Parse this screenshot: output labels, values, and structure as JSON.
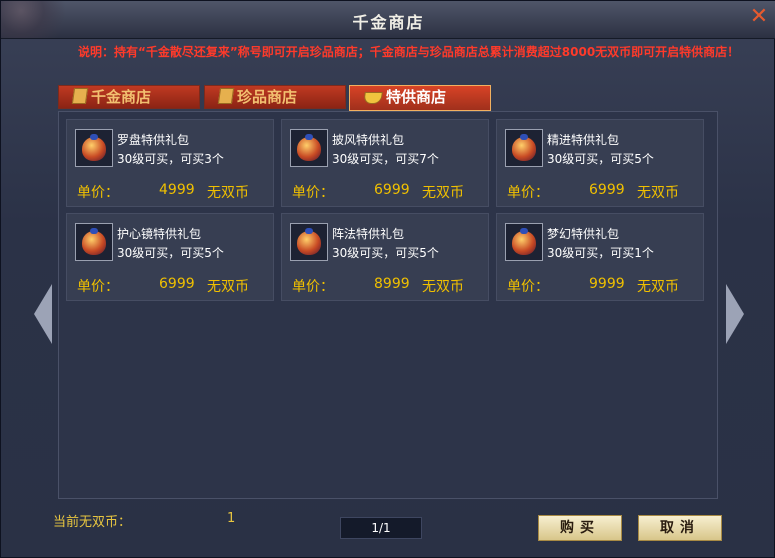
{
  "window": {
    "title": "千金商店",
    "close_label": "✕"
  },
  "notice": "说明：持有“千金散尽还复来”称号即可开启珍品商店；千金商店与珍品商店总累计消费超过8000无双币即可开启特供商店！",
  "tabs": [
    {
      "label": "千金商店",
      "active": false
    },
    {
      "label": "珍品商店",
      "active": false
    },
    {
      "label": "特供商店",
      "active": true
    }
  ],
  "items": [
    {
      "name": "罗盘特供礼包",
      "desc": "30级可买，可买3个",
      "price_label": "单价：",
      "price": "4999",
      "unit": "无双币"
    },
    {
      "name": "披风特供礼包",
      "desc": "30级可买，可买7个",
      "price_label": "单价：",
      "price": "6999",
      "unit": "无双币"
    },
    {
      "name": "精进特供礼包",
      "desc": "30级可买，可买5个",
      "price_label": "单价：",
      "price": "6999",
      "unit": "无双币"
    },
    {
      "name": "护心镜特供礼包",
      "desc": "30级可买，可买5个",
      "price_label": "单价：",
      "price": "6999",
      "unit": "无双币"
    },
    {
      "name": "阵法特供礼包",
      "desc": "30级可买，可买5个",
      "price_label": "单价：",
      "price": "8999",
      "unit": "无双币"
    },
    {
      "name": "梦幻特供礼包",
      "desc": "30级可买，可买1个",
      "price_label": "单价：",
      "price": "9999",
      "unit": "无双币"
    }
  ],
  "footer": {
    "balance_label": "当前无双币：",
    "balance_value": "1",
    "page_indicator": "1/1",
    "buy_label": "购买",
    "cancel_label": "取消"
  },
  "icons": {
    "close": "close-icon",
    "tab": "gold-ingot-icon",
    "item": "gift-bag-icon",
    "prev": "prev-arrow-icon",
    "next": "next-arrow-icon"
  }
}
